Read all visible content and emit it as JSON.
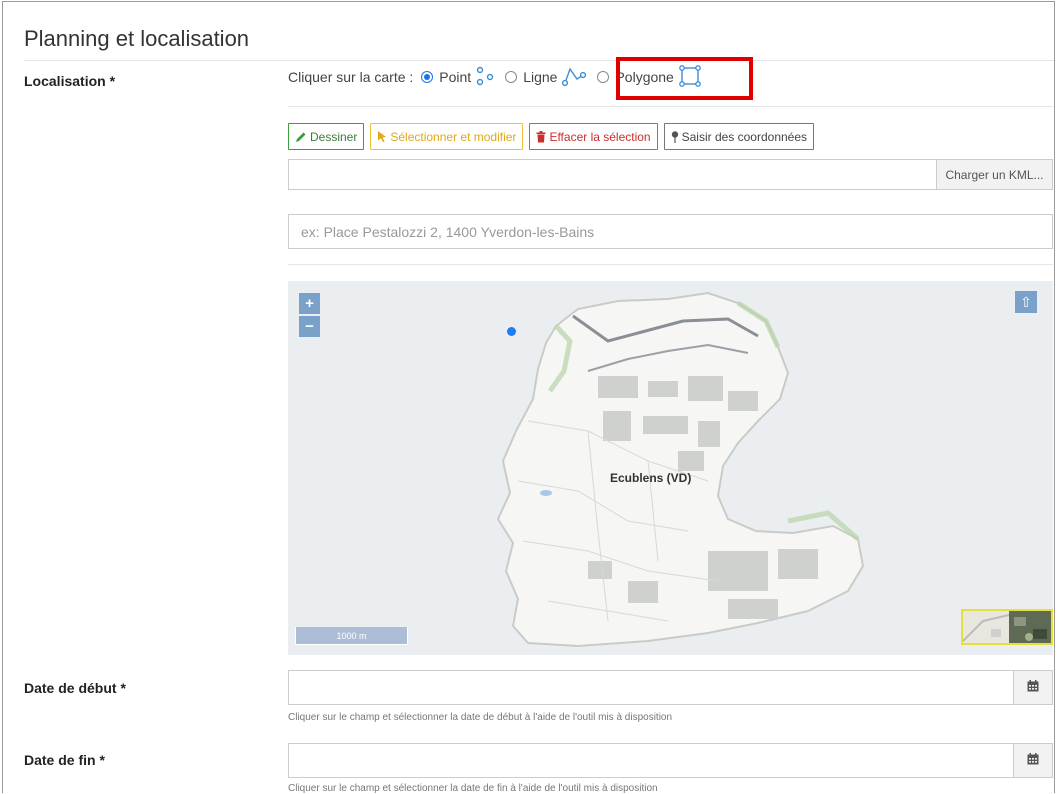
{
  "section": {
    "title": "Planning et localisation"
  },
  "localisation": {
    "label": "Localisation *",
    "prefix": "Cliquer sur la carte :",
    "options": [
      {
        "label": "Point",
        "checked": true,
        "icon": "point-icon"
      },
      {
        "label": "Ligne",
        "checked": false,
        "icon": "line-icon"
      },
      {
        "label": "Polygone",
        "checked": false,
        "icon": "polygon-icon"
      }
    ]
  },
  "toolbar": {
    "draw": {
      "label": "Dessiner",
      "icon": "pencil-icon",
      "color": "#3a9e3a"
    },
    "select": {
      "label": "Sélectionner et modifier",
      "icon": "cursor-icon",
      "color": "#f0c23a"
    },
    "erase": {
      "label": "Effacer la sélection",
      "icon": "trash-icon",
      "color": "#d9534f"
    },
    "coords": {
      "label": "Saisir des coordonnées",
      "icon": "map-pin-icon",
      "color": "#777777"
    }
  },
  "kml": {
    "value": "",
    "button": "Charger un KML..."
  },
  "address": {
    "placeholder": "ex: Place Pestalozzi 2, 1400 Yverdon-les-Bains"
  },
  "map": {
    "zoom_in": "+",
    "zoom_out": "−",
    "north": "⇧",
    "place_label": "Ecublens (VD)",
    "scale": "1000 m"
  },
  "start_date": {
    "label": "Date de début *",
    "value": "",
    "help": "Cliquer sur le champ et sélectionner la date de début à l'aide de l'outil mis à disposition"
  },
  "end_date": {
    "label": "Date de fin *",
    "value": "",
    "help": "Cliquer sur le champ et sélectionner la date de fin à l'aide de l'outil mis à disposition"
  },
  "colors": {
    "highlight": "#e00000",
    "accent": "#1a73e8",
    "map_control": "#7aa1c9"
  }
}
